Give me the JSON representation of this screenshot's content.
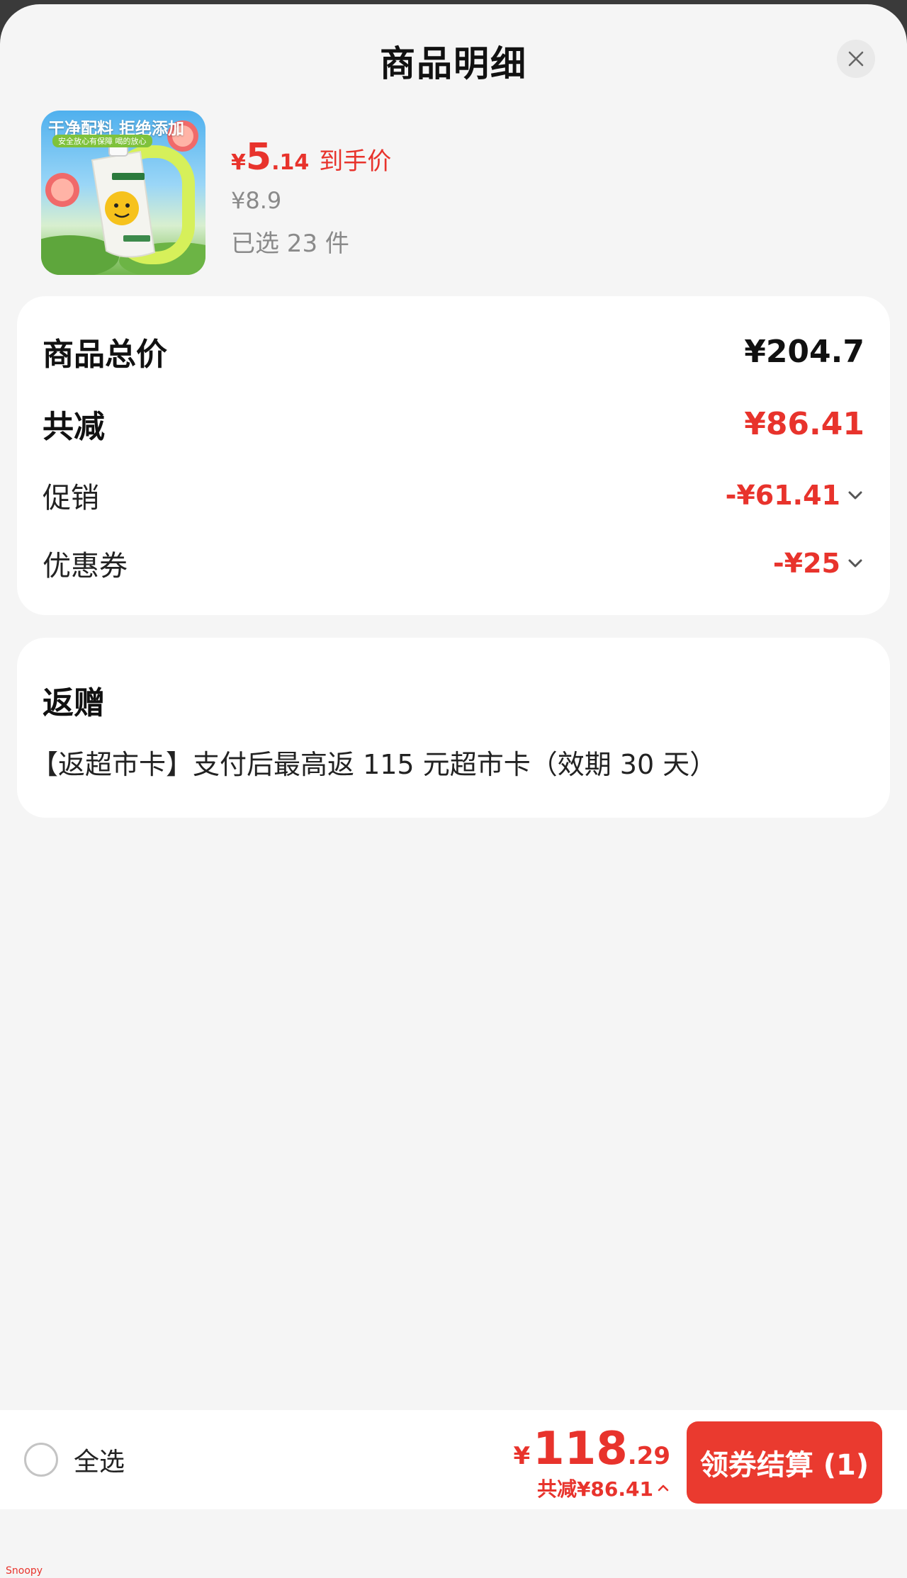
{
  "sheet": {
    "title": "商品明细"
  },
  "product": {
    "thumb_banner": "干净配料 拒绝添加",
    "thumb_sub": "安全放心有保障 喝的放心",
    "price_currency": "¥",
    "price_int": "5",
    "price_dec": ".14",
    "price_tag": "到手价",
    "original_price": "¥8.9",
    "selected_count": "已选 23 件"
  },
  "summary": {
    "total_label": "商品总价",
    "total_value": "¥204.7",
    "discount_label": "共减",
    "discount_value": "¥86.41",
    "promo_label": "促销",
    "promo_value": "-¥61.41",
    "coupon_label": "优惠券",
    "coupon_value": "-¥25"
  },
  "gift": {
    "title": "返赠",
    "text": "【返超市卡】支付后最高返 115 元超市卡（效期 30 天）"
  },
  "bottom_bar": {
    "select_all_label": "全选",
    "total_currency": "¥",
    "total_int": "118",
    "total_dec": ".29",
    "total_discount": "共减¥86.41",
    "checkout_label": "领券结算 (1)"
  },
  "watermark": "Snoopy",
  "colors": {
    "accent_red": "#e8332c",
    "checkout_button": "#ea3a2f",
    "sheet_background": "#f5f5f5"
  }
}
